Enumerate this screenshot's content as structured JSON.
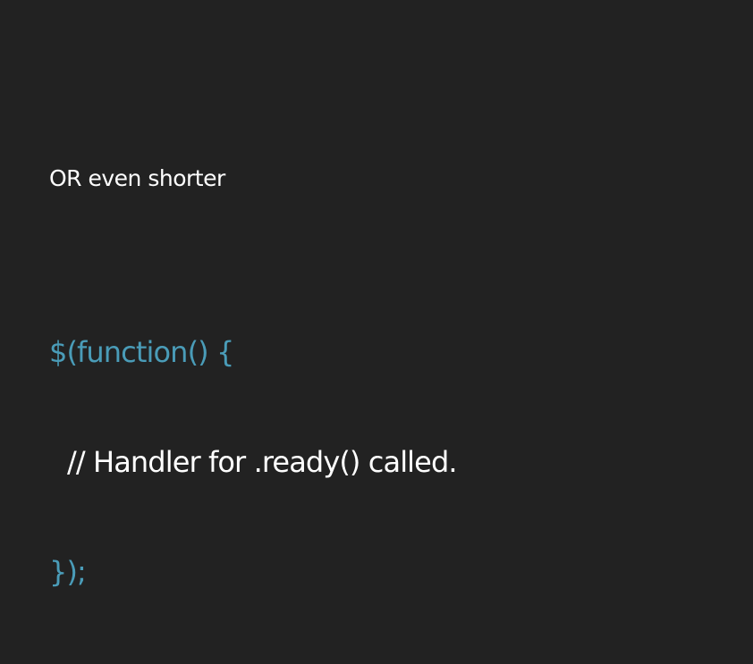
{
  "slide": {
    "subtitle": "OR even shorter",
    "code": {
      "line1": "$(function() {",
      "line2": "// Handler for .ready() called.",
      "line3": "});"
    }
  },
  "colors": {
    "background": "#222222",
    "text": "#ffffff",
    "accent": "#4a9cb8"
  }
}
